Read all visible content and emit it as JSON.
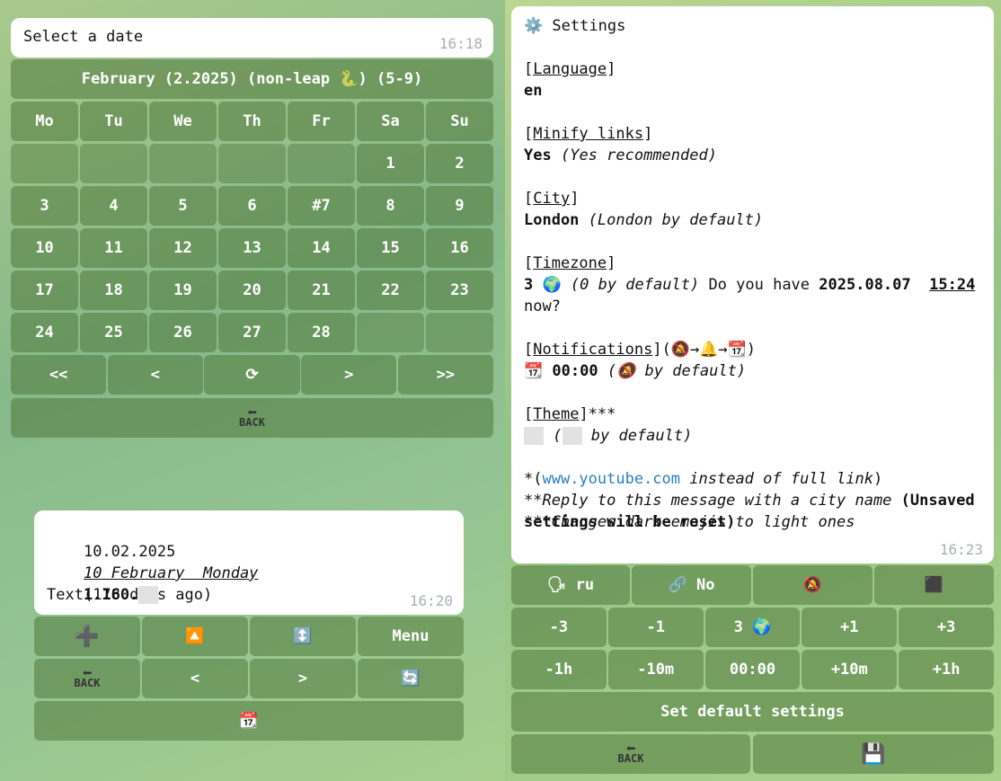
{
  "calendar": {
    "prompt": "Select a date",
    "prompt_time": "16:18",
    "month_title": "February (2.2025) (non-leap 🐍) (5-9)",
    "weekdays": [
      "Mo",
      "Tu",
      "We",
      "Th",
      "Fr",
      "Sa",
      "Su"
    ],
    "weeks": [
      [
        "",
        "",
        "",
        "",
        "",
        "1",
        "2"
      ],
      [
        "3",
        "4",
        "5",
        "6",
        "#7",
        "8",
        "9"
      ],
      [
        "10",
        "11",
        "12",
        "13",
        "14",
        "15",
        "16"
      ],
      [
        "17",
        "18",
        "19",
        "20",
        "21",
        "22",
        "23"
      ],
      [
        "24",
        "25",
        "26",
        "27",
        "28",
        "",
        ""
      ]
    ],
    "nav": [
      "<<",
      "<",
      "⟳",
      ">",
      ">>"
    ],
    "back_label": "BACK"
  },
  "event": {
    "date": "10.02.2025",
    "date_text": "10 February  Monday",
    "ago": "(178 days ago)",
    "number": "1.160.",
    "text": "Text",
    "time": "16:20",
    "buttons_row1": [
      "➕",
      "🔼",
      "↕️",
      "Menu"
    ],
    "buttons_row2": [
      "BACK",
      "<",
      ">",
      "🔄"
    ],
    "calendar_btn": "📆"
  },
  "settings": {
    "title": "Settings",
    "lang_key": "Language",
    "lang_val": "en",
    "minify_key": "Minify links",
    "minify_val": "Yes",
    "minify_note": "(Yes recommended)",
    "city_key": "City",
    "city_val": "London",
    "city_note": "(London by default)",
    "tz_key": "Timezone",
    "tz_val": "3 🌍",
    "tz_note": "(0 by default)",
    "tz_q1": "Do you have",
    "tz_date": "2025.08.07",
    "tz_clock": "15:24",
    "tz_q2": "now?",
    "notif_key": "Notifications",
    "notif_chain": "(🔕→🔔→📆)",
    "notif_val": "00:00",
    "notif_note_a": "(🔕",
    "notif_note_b": "by default)",
    "theme_key": "Theme",
    "theme_note": "by default)",
    "foot1_link": "www.youtube.com",
    "foot1_rest": "instead of full link",
    "foot2_i": "Reply to this message with a city name",
    "foot2_b": "(Unsaved settings will be reset)",
    "foot3": "Changes dark emojis to light ones",
    "time": "16:23",
    "row1": [
      "🗣 ru",
      "🔗 No",
      "🔕",
      "⬛"
    ],
    "row2": [
      "-3",
      "-1",
      "3 🌍",
      "+1",
      "+3"
    ],
    "row3": [
      "-1h",
      "-10m",
      "00:00",
      "+10m",
      "+1h"
    ],
    "default_btn": "Set default settings",
    "save_icon": "💾",
    "back_label": "BACK"
  }
}
